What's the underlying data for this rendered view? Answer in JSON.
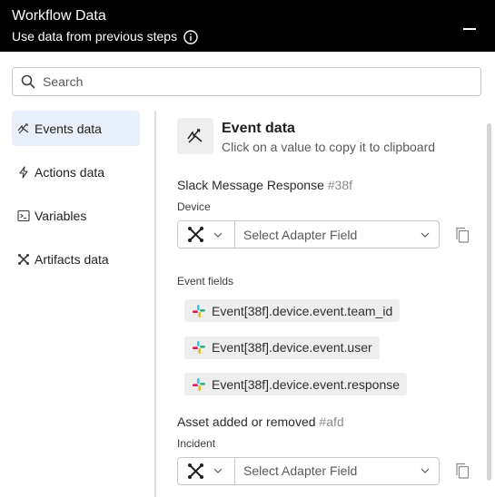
{
  "header": {
    "title": "Workflow Data",
    "subtitle": "Use data from previous steps",
    "info_icon": "info-circle-icon",
    "collapse_icon": "minus-icon"
  },
  "search": {
    "placeholder": "Search",
    "value": ""
  },
  "nav": {
    "items": [
      {
        "label": "Events data",
        "icon": "event-flow-icon",
        "active": true
      },
      {
        "label": "Actions data",
        "icon": "bolt-icon",
        "active": false
      },
      {
        "label": "Variables",
        "icon": "terminal-icon",
        "active": false
      },
      {
        "label": "Artifacts data",
        "icon": "artifacts-icon",
        "active": false
      }
    ]
  },
  "content": {
    "title": "Event data",
    "subtitle": "Click on a value to copy it to clipboard",
    "sections": [
      {
        "name": "Slack Message Response",
        "hash": "#38f",
        "field_label": "Device",
        "adapter_placeholder": "Select Adapter Field",
        "event_fields_label": "Event fields",
        "event_fields": [
          "Event[38f].device.event.team_id",
          "Event[38f].device.event.user",
          "Event[38f].device.event.response"
        ]
      },
      {
        "name": "Asset added or removed",
        "hash": "#afd",
        "field_label": "Incident",
        "adapter_placeholder": "Select Adapter Field"
      }
    ]
  },
  "colors": {
    "header_bg": "#000000",
    "active_nav_bg": "#e8f0fb",
    "chip_bg": "#eeeeee"
  }
}
